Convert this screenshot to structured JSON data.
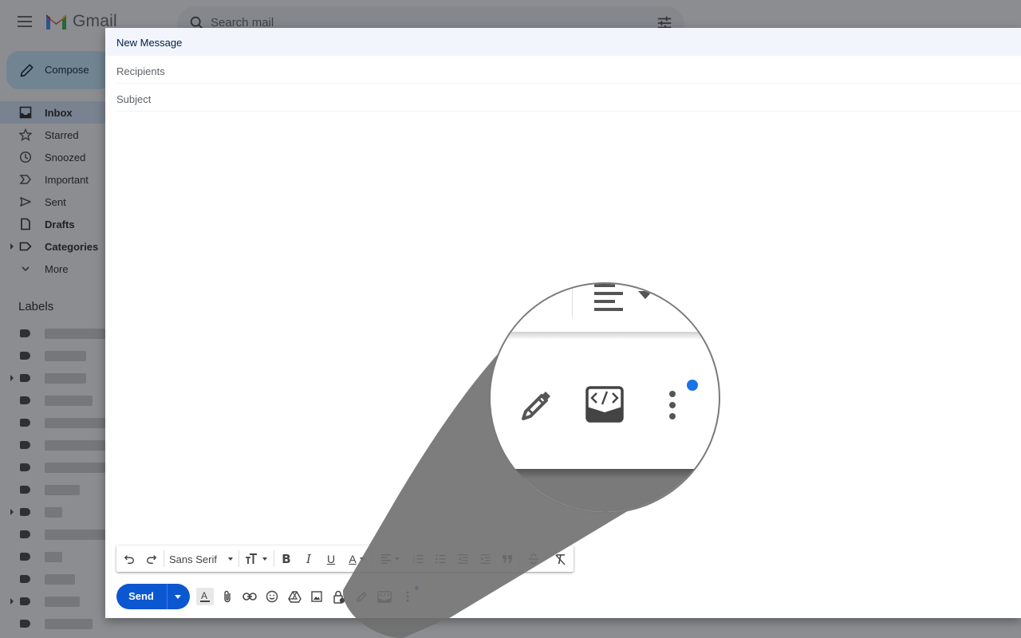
{
  "app": {
    "name": "Gmail"
  },
  "search": {
    "placeholder": "Search mail"
  },
  "sidebar": {
    "compose_label": "Compose",
    "items": [
      {
        "label": "Inbox",
        "icon": "inbox-icon",
        "active": true,
        "bold": true
      },
      {
        "label": "Starred",
        "icon": "star-icon"
      },
      {
        "label": "Snoozed",
        "icon": "clock-icon"
      },
      {
        "label": "Important",
        "icon": "important-icon"
      },
      {
        "label": "Sent",
        "icon": "send-icon"
      },
      {
        "label": "Drafts",
        "icon": "draft-icon",
        "bold": true
      },
      {
        "label": "Categories",
        "icon": "label-outline-icon",
        "bold": true,
        "expandable": true
      },
      {
        "label": "More",
        "icon": "chevron-down-icon"
      }
    ],
    "labels_heading": "Labels"
  },
  "compose": {
    "title": "New Message",
    "recipients_placeholder": "Recipients",
    "subject_placeholder": "Subject",
    "formatting": {
      "undo": "undo-icon",
      "redo": "redo-icon",
      "font": "Sans Serif",
      "size": "size-icon",
      "bold": "B",
      "italic": "I",
      "underline": "U",
      "text_color": "A"
    },
    "send_label": "Send"
  },
  "colors": {
    "accent": "#0b57d0",
    "compose_button": "#c2e7ff",
    "active_nav": "#d3e3fd",
    "notification_dot": "#1a73e8"
  }
}
